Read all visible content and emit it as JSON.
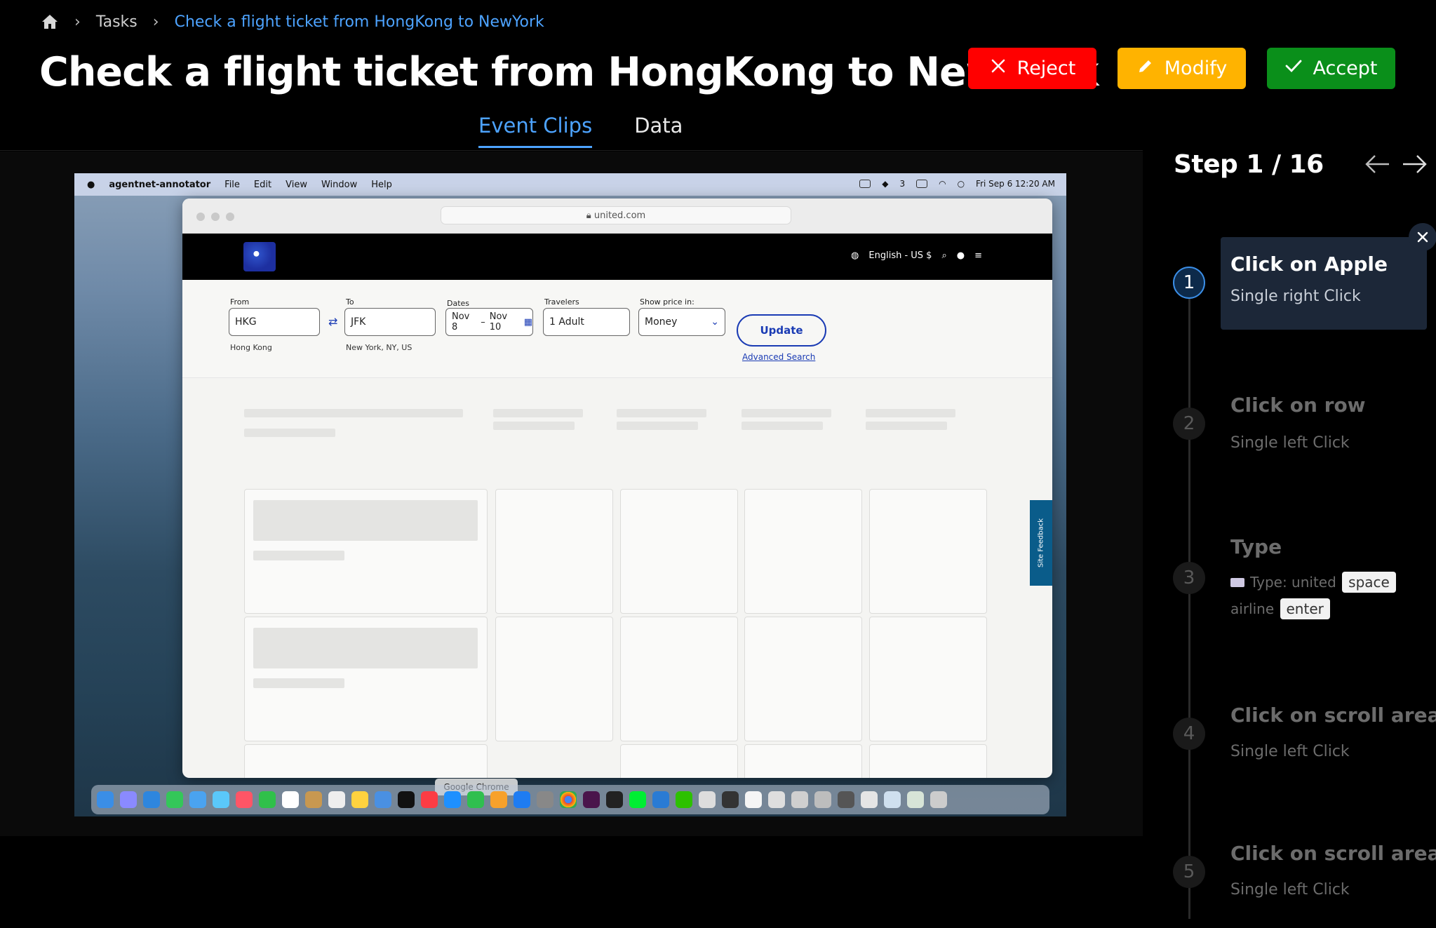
{
  "breadcrumb": {
    "items": [
      "Tasks",
      "Check a flight ticket from HongKong to NewYork"
    ]
  },
  "header": {
    "title": "Check a flight ticket from HongKong to NewYork",
    "buttons": {
      "reject": "Reject",
      "modify": "Modify",
      "accept": "Accept"
    },
    "colors": {
      "reject": "#ff0000",
      "modify": "#ffb300",
      "accept": "#0a8f1a"
    }
  },
  "tabs": [
    {
      "label": "Event Clips",
      "active": true
    },
    {
      "label": "Data",
      "active": false
    }
  ],
  "screenshot": {
    "menubar": {
      "app": "agentnet-annotator",
      "menus": [
        "File",
        "Edit",
        "View",
        "Window",
        "Help"
      ],
      "count": "3",
      "clock": "Fri Sep 6  12:20 AM"
    },
    "browser": {
      "url": "united.com",
      "header_locale": "English - US $",
      "from_label": "From",
      "from_value": "HKG",
      "from_city": "Hong Kong",
      "to_label": "To",
      "to_value": "JFK",
      "to_city": "New York, NY, US",
      "dates_label": "Dates",
      "date_start": "Nov 8",
      "date_sep": "–",
      "date_end": "Nov 10",
      "travelers_label": "Travelers",
      "travelers_value": "1 Adult",
      "price_label": "Show price in:",
      "price_value": "Money",
      "update_label": "Update",
      "advanced_search": "Advanced Search",
      "site_feedback": "Site Feedback"
    },
    "dock_tooltip": "Google Chrome"
  },
  "steps_panel": {
    "heading": "Step 1 / 16",
    "steps": [
      {
        "num": "1",
        "title": "Click on Apple",
        "sub": "Single right Click"
      },
      {
        "num": "2",
        "title": "Click on row",
        "sub": "Single left Click"
      },
      {
        "num": "3",
        "title": "Type",
        "type_prefix": "Type: united",
        "key1": "space",
        "word2": "airline",
        "key2": "enter"
      },
      {
        "num": "4",
        "title": "Click on scroll area",
        "sub": "Single left Click"
      },
      {
        "num": "5",
        "title": "Click on scroll area",
        "sub": "Single left Click"
      }
    ]
  }
}
